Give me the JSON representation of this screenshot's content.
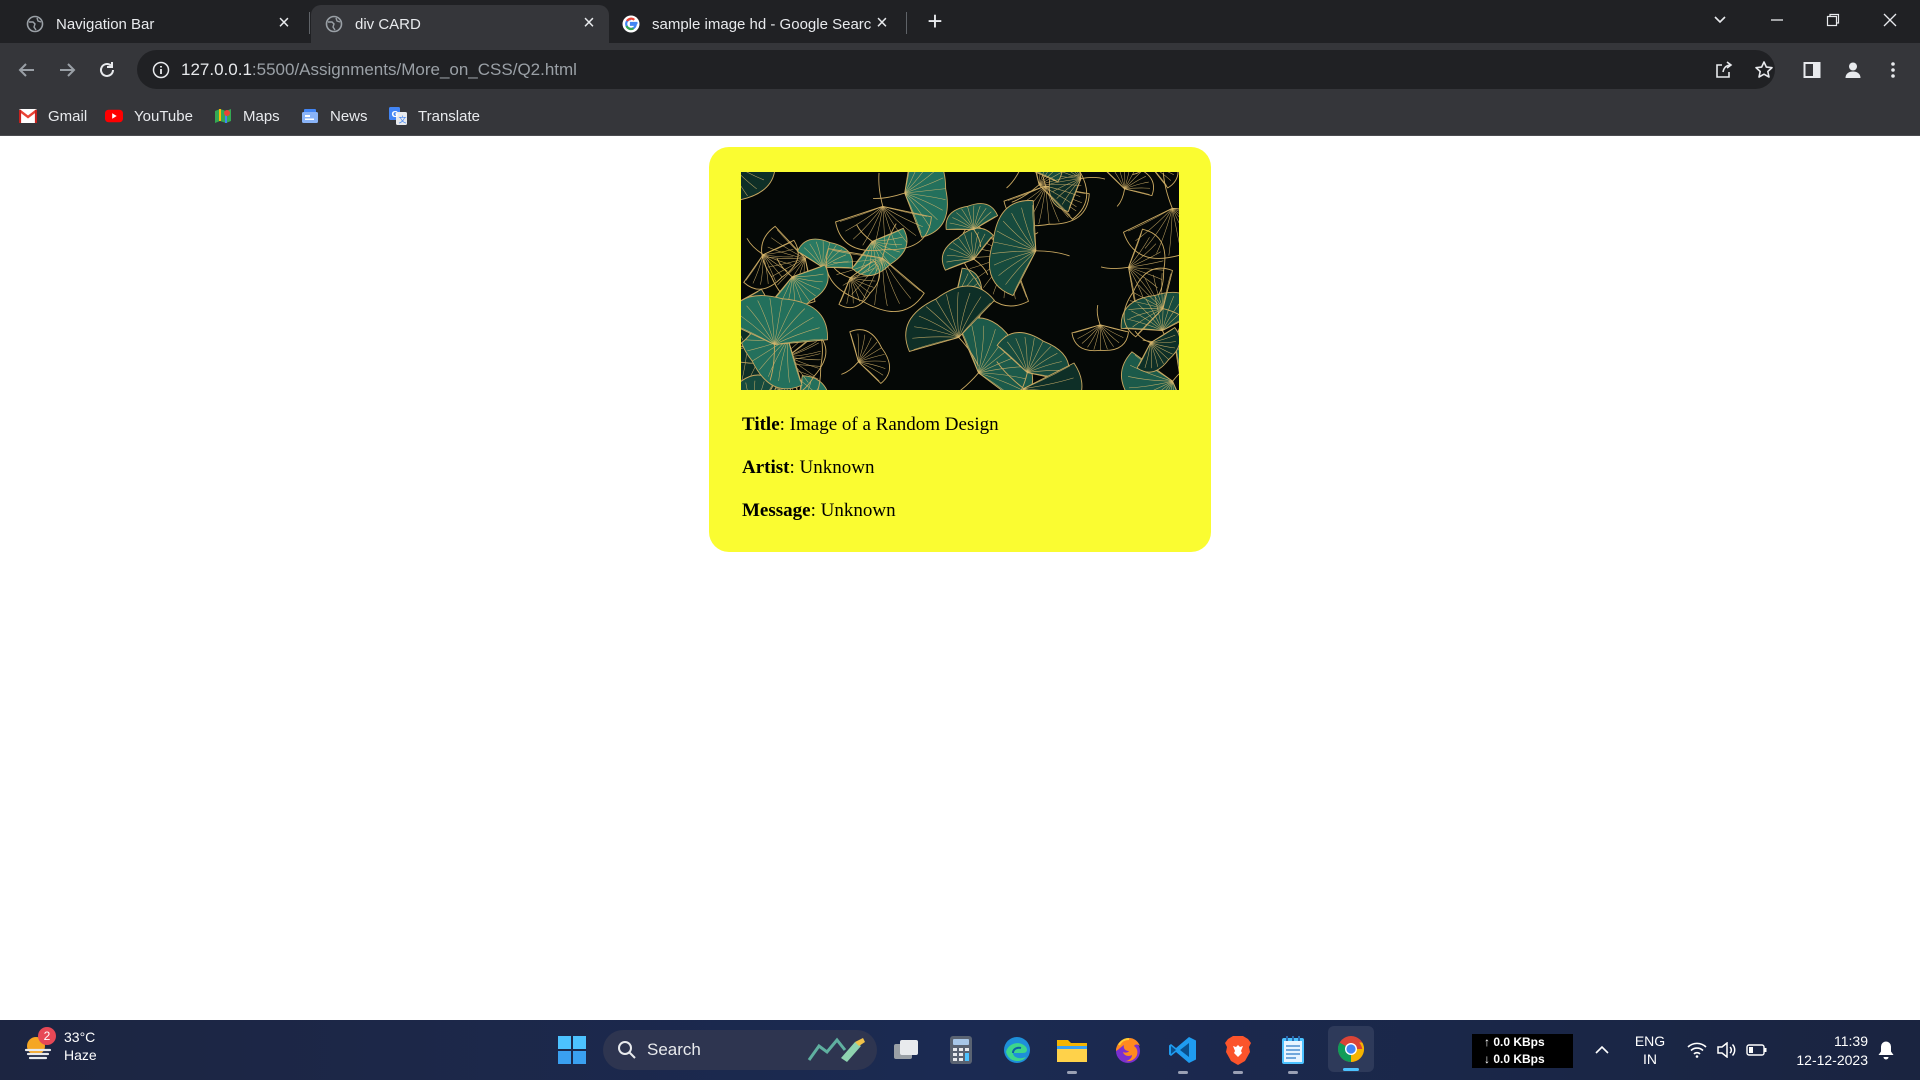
{
  "browser": {
    "tabs": [
      {
        "title": "Navigation Bar",
        "icon": "globe-icon",
        "active": false
      },
      {
        "title": "div CARD",
        "icon": "globe-icon",
        "active": true
      },
      {
        "title": "sample image hd - Google Search",
        "icon": "google-icon",
        "active": false
      }
    ],
    "url_host": "127.0.0.1",
    "url_path": ":5500/Assignments/More_on_CSS/Q2.html",
    "bookmarks": [
      {
        "label": "Gmail",
        "icon": "gmail-icon"
      },
      {
        "label": "YouTube",
        "icon": "youtube-icon"
      },
      {
        "label": "Maps",
        "icon": "maps-icon"
      },
      {
        "label": "News",
        "icon": "news-icon"
      },
      {
        "label": "Translate",
        "icon": "translate-icon"
      }
    ]
  },
  "card": {
    "background": "#fafc31",
    "image_alt": "Image of a Random Design",
    "fields": [
      {
        "label": "Title",
        "value": ": Image of a Random Design"
      },
      {
        "label": "Artist",
        "value": ": Unknown"
      },
      {
        "label": "Message",
        "value": ": Unknown"
      }
    ]
  },
  "taskbar": {
    "weather_temp": "33°C",
    "weather_desc": "Haze",
    "weather_badge": "2",
    "search_label": "Search",
    "net_up": "↑ 0.0 KBps",
    "net_down": "↓ 0.0 KBps",
    "lang_1": "ENG",
    "lang_2": "IN",
    "time": "11:39",
    "date": "12-12-2023"
  }
}
